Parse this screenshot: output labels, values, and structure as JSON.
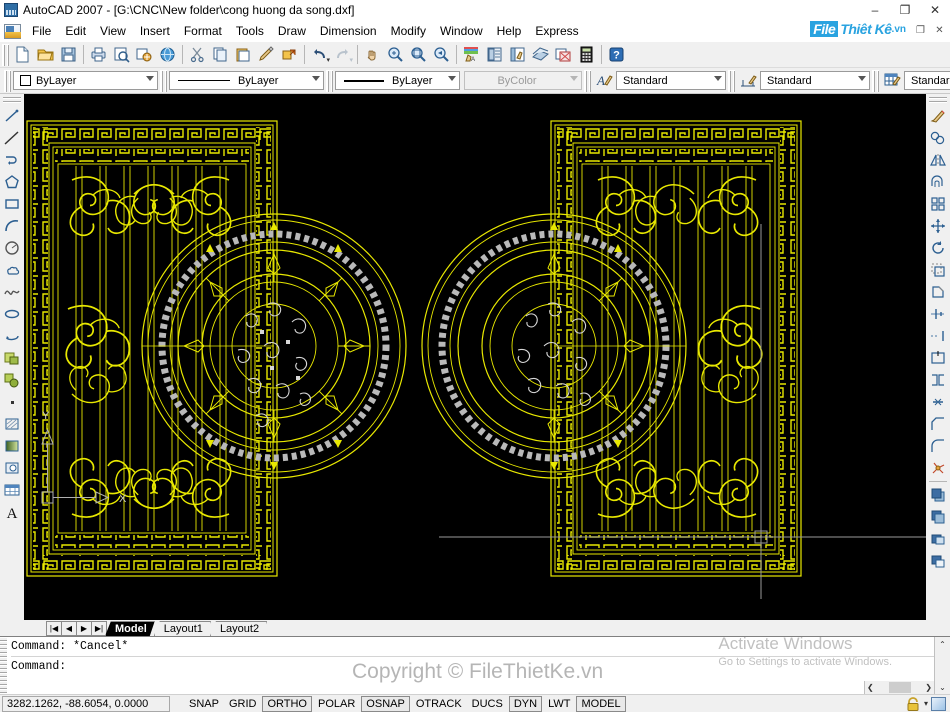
{
  "window": {
    "title": "AutoCAD 2007 - [G:\\CNC\\New folder\\cong huong da song.dxf]",
    "app_icon": "autocad-icon",
    "minimize": "–",
    "maximize": "❐",
    "close": "✕",
    "doc_restore": "❐",
    "doc_close": "✕"
  },
  "brand": {
    "part1": "File",
    "part2": "Thiêt Kê",
    "part3": ".vn"
  },
  "menu": {
    "items": [
      {
        "label": "File"
      },
      {
        "label": "Edit"
      },
      {
        "label": "View"
      },
      {
        "label": "Insert"
      },
      {
        "label": "Format"
      },
      {
        "label": "Tools"
      },
      {
        "label": "Draw"
      },
      {
        "label": "Dimension"
      },
      {
        "label": "Modify"
      },
      {
        "label": "Window"
      },
      {
        "label": "Help"
      },
      {
        "label": "Express"
      }
    ]
  },
  "standard_toolbar": {
    "buttons": [
      {
        "name": "new-icon",
        "tip": "QNew"
      },
      {
        "name": "open-icon",
        "tip": "Open"
      },
      {
        "name": "save-icon",
        "tip": "Save"
      },
      {
        "name": "plot-icon",
        "tip": "Plot"
      },
      {
        "name": "plot-preview-icon",
        "tip": "Plot Preview"
      },
      {
        "name": "publish-icon",
        "tip": "Publish"
      },
      {
        "name": "etransmit-icon",
        "tip": "Publish to Web"
      },
      {
        "name": "cut-icon",
        "tip": "Cut"
      },
      {
        "name": "copy-icon",
        "tip": "Copy"
      },
      {
        "name": "paste-icon",
        "tip": "Paste"
      },
      {
        "name": "match-properties-icon",
        "tip": "Match Properties"
      },
      {
        "name": "block-editor-icon",
        "tip": "Block Editor"
      },
      {
        "name": "undo-icon",
        "tip": "Undo"
      },
      {
        "name": "redo-icon",
        "tip": "Redo"
      },
      {
        "name": "pan-icon",
        "tip": "Pan Realtime"
      },
      {
        "name": "zoom-realtime-icon",
        "tip": "Zoom Realtime"
      },
      {
        "name": "zoom-window-icon",
        "tip": "Zoom Window"
      },
      {
        "name": "zoom-previous-icon",
        "tip": "Zoom Previous"
      },
      {
        "name": "properties-icon",
        "tip": "Properties"
      },
      {
        "name": "designcenter-icon",
        "tip": "DesignCenter"
      },
      {
        "name": "tool-palettes-icon",
        "tip": "Tool Palettes"
      },
      {
        "name": "sheet-set-icon",
        "tip": "Sheet Set Manager"
      },
      {
        "name": "markup-set-icon",
        "tip": "Markup Set Manager"
      },
      {
        "name": "quickcalc-icon",
        "tip": "QuickCalc"
      },
      {
        "name": "help-icon",
        "tip": "Help"
      }
    ]
  },
  "properties_toolbar": {
    "layer_color": {
      "value": "ByLayer",
      "swatch": "#ffffff"
    },
    "linetype": {
      "value": "ByLayer"
    },
    "lineweight": {
      "value": "ByLayer"
    },
    "plotstyle": {
      "value": "ByColor",
      "disabled": true
    },
    "text_style": {
      "value": "Standard",
      "icon": "text-style-icon"
    },
    "dim_style": {
      "value": "Standard",
      "icon": "dimension-style-icon"
    },
    "table_style": {
      "value": "Standard",
      "icon": "table-style-icon"
    }
  },
  "draw_toolbar": {
    "buttons": [
      {
        "name": "line-icon"
      },
      {
        "name": "construction-line-icon"
      },
      {
        "name": "polyline-icon"
      },
      {
        "name": "polygon-icon"
      },
      {
        "name": "rectangle-icon"
      },
      {
        "name": "arc-icon"
      },
      {
        "name": "circle-icon"
      },
      {
        "name": "revision-cloud-icon"
      },
      {
        "name": "spline-icon"
      },
      {
        "name": "ellipse-icon"
      },
      {
        "name": "ellipse-arc-icon"
      },
      {
        "name": "insert-block-icon"
      },
      {
        "name": "make-block-icon"
      },
      {
        "name": "point-icon"
      },
      {
        "name": "hatch-icon"
      },
      {
        "name": "gradient-icon"
      },
      {
        "name": "region-icon"
      },
      {
        "name": "table-icon"
      },
      {
        "name": "multiline-text-icon"
      }
    ]
  },
  "modify_toolbar": {
    "buttons": [
      {
        "name": "erase-icon"
      },
      {
        "name": "copy-object-icon"
      },
      {
        "name": "mirror-icon"
      },
      {
        "name": "offset-icon"
      },
      {
        "name": "array-icon"
      },
      {
        "name": "move-icon"
      },
      {
        "name": "rotate-icon"
      },
      {
        "name": "scale-icon"
      },
      {
        "name": "stretch-icon"
      },
      {
        "name": "trim-icon"
      },
      {
        "name": "extend-icon"
      },
      {
        "name": "break-at-point-icon"
      },
      {
        "name": "break-icon"
      },
      {
        "name": "join-icon"
      },
      {
        "name": "chamfer-icon"
      },
      {
        "name": "fillet-icon"
      },
      {
        "name": "explode-icon"
      },
      {
        "name": "draworder-bring-front-icon"
      },
      {
        "name": "draworder-send-back-icon"
      },
      {
        "name": "draworder-bring-above-icon"
      },
      {
        "name": "draworder-send-under-icon"
      }
    ]
  },
  "canvas": {
    "background": "#000000",
    "ucs": {
      "x_label": "X",
      "y_label": "Y"
    },
    "colors": {
      "yellow": "#e8e800",
      "white": "#d8d8d8",
      "gray": "#9a9a9a"
    }
  },
  "layout_tabs": {
    "nav": [
      "|◀",
      "◀",
      "▶",
      "▶|"
    ],
    "tabs": [
      {
        "label": "Model",
        "active": true
      },
      {
        "label": "Layout1",
        "active": false
      },
      {
        "label": "Layout2",
        "active": false
      }
    ]
  },
  "command_line": {
    "lines": [
      "Command: *Cancel*",
      "Command:"
    ],
    "scroll_up": "⌃",
    "scroll_down": "⌄",
    "h_left": "❮",
    "h_right": "❯"
  },
  "status_bar": {
    "coordinates": "3282.1262, -88.6054, 0.0000",
    "toggles": [
      {
        "label": "SNAP",
        "active": false
      },
      {
        "label": "GRID",
        "active": false
      },
      {
        "label": "ORTHO",
        "active": true
      },
      {
        "label": "POLAR",
        "active": false
      },
      {
        "label": "OSNAP",
        "active": true
      },
      {
        "label": "OTRACK",
        "active": false
      },
      {
        "label": "DUCS",
        "active": false
      },
      {
        "label": "DYN",
        "active": true
      },
      {
        "label": "LWT",
        "active": false
      },
      {
        "label": "MODEL",
        "active": true
      }
    ],
    "tray": {
      "lock_icon": "lock-icon",
      "arrow": "▾",
      "maximize_icon": "restore-icon"
    }
  },
  "watermarks": {
    "copyright": "Copyright © FileThietKe.vn",
    "activate_title": "Activate Windows",
    "activate_sub": "Go to Settings to activate Windows."
  }
}
